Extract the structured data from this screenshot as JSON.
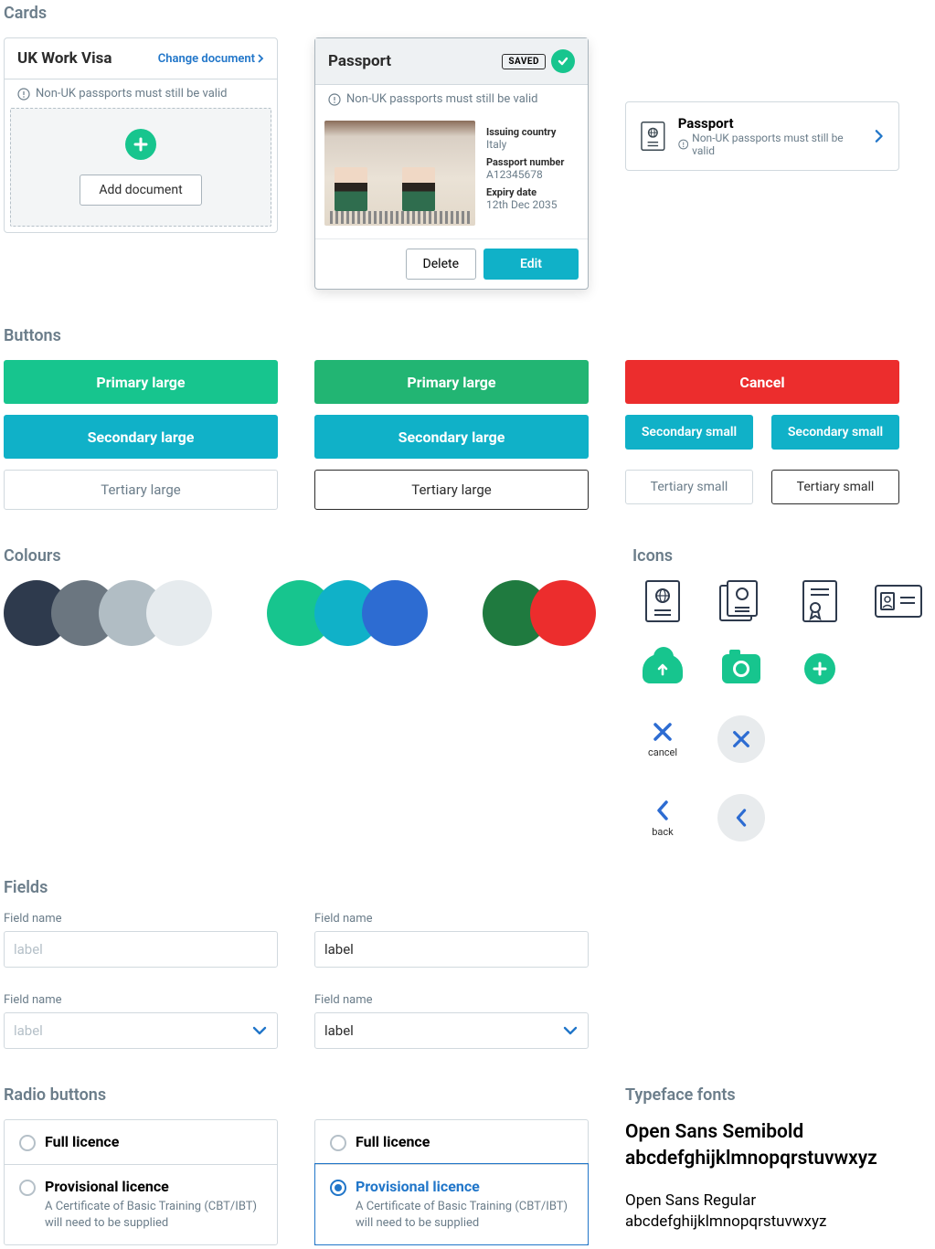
{
  "sections": {
    "cards": "Cards",
    "buttons": "Buttons",
    "colours": "Colours",
    "icons": "Icons",
    "fields": "Fields",
    "radio": "Radio buttons",
    "typeface": "Typeface fonts"
  },
  "card1": {
    "title": "UK Work Visa",
    "change_link": "Change document",
    "warning": "Non-UK passports must still be valid",
    "add_doc": "Add document"
  },
  "card2": {
    "title": "Passport",
    "saved_badge": "SAVED",
    "warning": "Non-UK passports must still be valid",
    "meta": {
      "l1": "Issuing country",
      "v1": "Italy",
      "l2": "Passport number",
      "v2": "A12345678",
      "l3": "Expiry date",
      "v3": "12th Dec 2035"
    },
    "delete": "Delete",
    "edit": "Edit"
  },
  "card3": {
    "title": "Passport",
    "sub": "Non-UK passports must still be valid"
  },
  "buttons": {
    "primary": "Primary large",
    "cancel": "Cancel",
    "secondary": "Secondary large",
    "secondary_small": "Secondary small",
    "tertiary": "Tertiary large",
    "tertiary_small": "Tertiary small"
  },
  "colours": [
    [
      "#2e3a4d",
      "#6b7680",
      "#b1bdc4",
      "#e6ebee"
    ],
    [
      "#17c58e",
      "#10b1c8",
      "#2d6cd2"
    ],
    [
      "#1f7a3f",
      "#ec2d2d"
    ]
  ],
  "icons": {
    "cancel_label": "cancel",
    "back_label": "back"
  },
  "fields": {
    "label": "Field name",
    "placeholder": "label",
    "value": "label"
  },
  "radio": {
    "opt1": {
      "label": "Full licence"
    },
    "opt2": {
      "label": "Provisional licence",
      "sub": "A Certificate of Basic Training (CBT/IBT) will need to be supplied"
    }
  },
  "typeface": {
    "bold_name": "Open Sans Semibold",
    "bold_sample": "abcdefghijklmnopqrstuvwxyz",
    "reg_name": "Open Sans Regular",
    "reg_sample": "abcdefghijklmnopqrstuvwxyz"
  }
}
